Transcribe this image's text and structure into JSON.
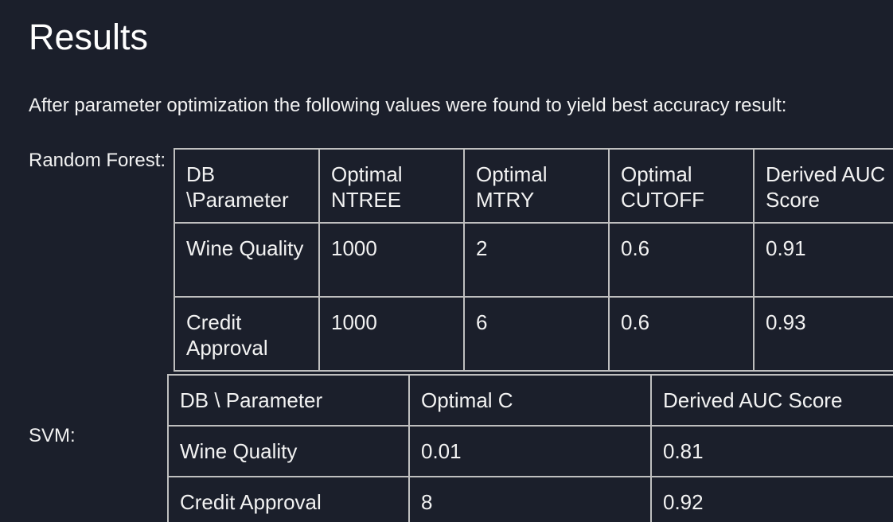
{
  "page": {
    "title": "Results",
    "intro": "After parameter optimization the following values were found to yield best accuracy result:"
  },
  "random_forest": {
    "label": "Random Forest:",
    "headers": [
      "DB \\Parameter",
      "Optimal NTREE",
      "Optimal MTRY",
      "Optimal CUTOFF",
      "Derived AUC Score"
    ],
    "rows": [
      [
        "Wine Quality",
        "1000",
        "2",
        "0.6",
        "0.91"
      ],
      [
        "Credit Approval",
        "1000",
        "6",
        "0.6",
        "0.93"
      ]
    ]
  },
  "svm": {
    "label": "SVM:",
    "headers": [
      "DB \\ Parameter",
      "Optimal C",
      "Derived AUC Score"
    ],
    "rows": [
      [
        "Wine Quality",
        "0.01",
        "0.81"
      ],
      [
        "Credit Approval",
        "8",
        "0.92"
      ]
    ]
  },
  "colors": {
    "background": "#1b1f2b",
    "text": "#f2f2f2",
    "border": "#bfbfbf"
  }
}
